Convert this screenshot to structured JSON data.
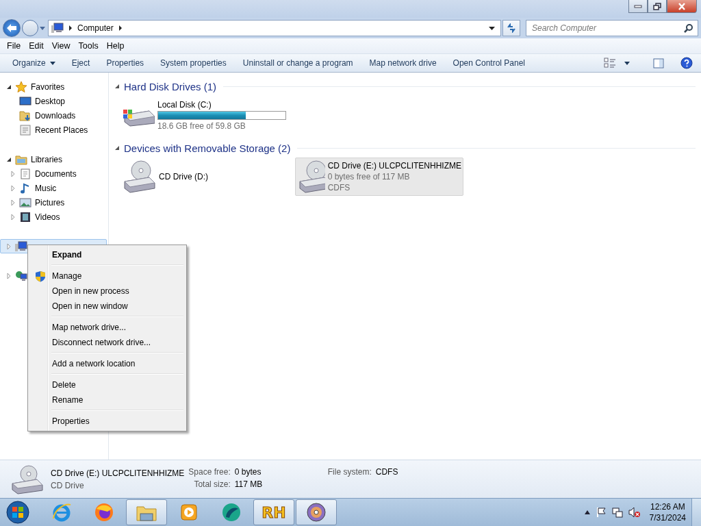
{
  "address_bar": {
    "path": [
      "Computer"
    ]
  },
  "search": {
    "placeholder": "Search Computer"
  },
  "menu_bar": [
    "File",
    "Edit",
    "View",
    "Tools",
    "Help"
  ],
  "toolbar": [
    {
      "label": "Organize",
      "dropdown": true
    },
    {
      "label": "Eject",
      "dropdown": false
    },
    {
      "label": "Properties",
      "dropdown": false
    },
    {
      "label": "System properties",
      "dropdown": false
    },
    {
      "label": "Uninstall or change a program",
      "dropdown": false
    },
    {
      "label": "Map network drive",
      "dropdown": false
    },
    {
      "label": "Open Control Panel",
      "dropdown": false
    }
  ],
  "sidebar": [
    {
      "kind": "star",
      "label": "Favorites",
      "expanded": true,
      "selected": false,
      "children": [
        {
          "kind": "desktop",
          "label": "Desktop",
          "expandable": false
        },
        {
          "kind": "downloads",
          "label": "Downloads",
          "expandable": false
        },
        {
          "kind": "recent",
          "label": "Recent Places",
          "expandable": false
        }
      ]
    },
    {
      "kind": "library",
      "label": "Libraries",
      "expanded": true,
      "selected": false,
      "children": [
        {
          "kind": "document",
          "label": "Documents",
          "expandable": true
        },
        {
          "kind": "music",
          "label": "Music",
          "expandable": true
        },
        {
          "kind": "pictures",
          "label": "Pictures",
          "expandable": true
        },
        {
          "kind": "videos",
          "label": "Videos",
          "expandable": true
        }
      ]
    },
    {
      "kind": "computer",
      "expanded": false,
      "selected": true
    },
    {
      "kind": "network",
      "expanded": false,
      "selected": false
    }
  ],
  "sections": [
    {
      "title": "Hard Disk Drives (1)",
      "expanded": true,
      "items": [
        {
          "kind": "disk",
          "name": "Local Disk (C:)",
          "level": 0.69,
          "info": "18.6 GB free of 59.8 GB",
          "selected": false
        }
      ]
    },
    {
      "title": "Devices with Removable Storage (2)",
      "expanded": true,
      "items": [
        {
          "kind": "cd",
          "name": "CD Drive (D:)",
          "selected": false
        },
        {
          "kind": "cd",
          "name": "CD Drive (E:) ULCPCLITENHHIZME",
          "info": "0 bytes free of 117 MB",
          "subinfo": "CDFS",
          "selected": true
        }
      ]
    }
  ],
  "context_menu": [
    [
      {
        "label": "Expand",
        "default": true,
        "shield": false
      }
    ],
    [
      {
        "label": "Manage",
        "default": false,
        "shield": true
      },
      {
        "label": "Open in new process",
        "default": false,
        "shield": false
      },
      {
        "label": "Open in new window",
        "default": false,
        "shield": false
      }
    ],
    [
      {
        "label": "Map network drive...",
        "default": false,
        "shield": false
      },
      {
        "label": "Disconnect network drive...",
        "default": false,
        "shield": false
      }
    ],
    [
      {
        "label": "Add a network location",
        "default": false,
        "shield": false
      }
    ],
    [
      {
        "label": "Delete",
        "default": false,
        "shield": false
      },
      {
        "label": "Rename",
        "default": false,
        "shield": false
      }
    ],
    [
      {
        "label": "Properties",
        "default": false,
        "shield": false
      }
    ]
  ],
  "details": {
    "name": "CD Drive (E:) ULCPCLITENHHIZME",
    "type": "CD Drive",
    "fields": [
      {
        "label": "Space free:",
        "value": "0 bytes"
      },
      {
        "label": "Total size:",
        "value": "117 MB"
      },
      {
        "label": "File system:",
        "value": "CDFS"
      }
    ]
  },
  "taskbar": {
    "items": [
      {
        "kind": "ie",
        "active": false
      },
      {
        "kind": "firefox",
        "active": false
      },
      {
        "kind": "explorer",
        "active": true
      },
      {
        "kind": "media",
        "active": false
      },
      {
        "kind": "app",
        "active": false
      },
      {
        "kind": "rh",
        "label": "RH",
        "active": true
      },
      {
        "kind": "disc",
        "active": true
      }
    ],
    "time": "12:26 AM",
    "date": "7/31/2024"
  }
}
